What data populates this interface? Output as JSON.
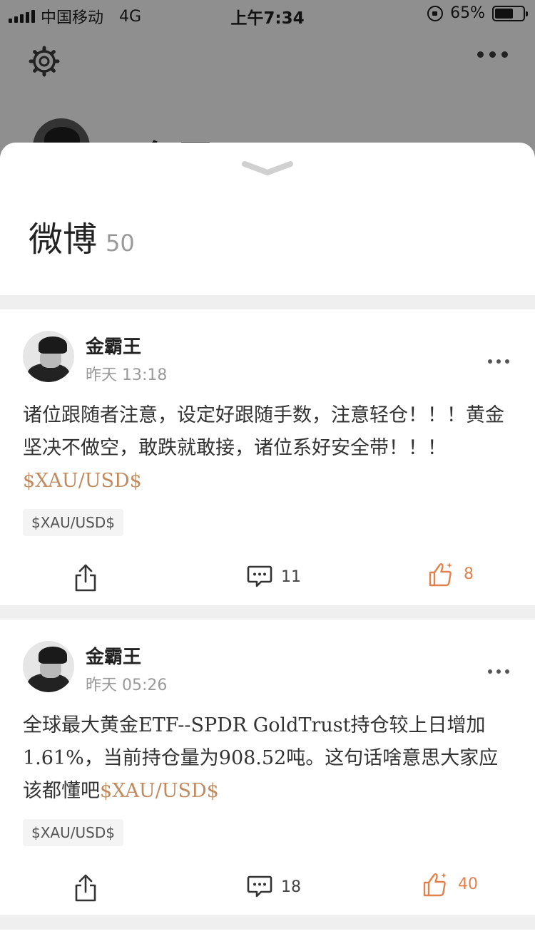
{
  "status_bar": {
    "carrier": "中国移动",
    "network": "4G",
    "time": "上午7:34",
    "battery": "65%",
    "battery_level": 0.65
  },
  "background": {
    "profile_name": "金霸王",
    "icons": [
      "gear-icon",
      "more-icon"
    ]
  },
  "sheet": {
    "title": "微博",
    "count": "50",
    "handle_icon": "chevron-down-icon"
  },
  "posts": [
    {
      "author": "金霸王",
      "time": "昨天 13:18",
      "text": "诸位跟随者注意，设定好跟随手数，注意轻仓！！！黄金坚决不做空，敢跌就敢接，诸位系好安全带！！！",
      "link": "$XAU/USD$",
      "tag": "$XAU/USD$",
      "comments": "11",
      "likes": "8"
    },
    {
      "author": "金霸王",
      "time": "昨天 05:26",
      "text": "全球最大黄金ETF--SPDR GoldTrust持仓较上日增加1.61%，当前持仓量为908.52吨。这句话啥意思大家应该都懂吧",
      "link": "$XAU/USD$",
      "tag": "$XAU/USD$",
      "comments": "18",
      "likes": "40"
    }
  ],
  "colors": {
    "accent": "#e0824f",
    "link": "#c28a5e",
    "backdrop": "#8f8f8f",
    "divider": "#efefef"
  }
}
